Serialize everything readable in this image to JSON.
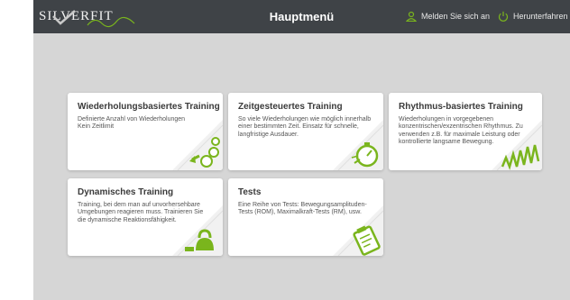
{
  "header": {
    "logo_text": "SILVERFIT",
    "title": "Hauptmenü",
    "login_label": "Melden Sie sich an",
    "shutdown_label": "Herunterfahren"
  },
  "colors": {
    "topbar": "#3f4347",
    "accent": "#7ab51d",
    "background": "#d6d6d6",
    "card": "#ffffff"
  },
  "cards": [
    {
      "title": "Wiederholungsbasiertes Training",
      "description": "Definierte Anzahl von Wiederholungen\nKein Zeitlimit",
      "icon": "repetition-counter-icon"
    },
    {
      "title": "Zeitgesteuertes Training",
      "description": "So viele Wiederholungen wie möglich innerhalb einer bestimmten Zeit. Einsatz für schnelle, langfristige Ausdauer.",
      "icon": "stopwatch-icon"
    },
    {
      "title": "Rhythmus-basiertes Training",
      "description": "Wiederholungen in vorgegebenen konzentrischen/exzentrischen Rhythmus. Zu verwenden z.B. für maximale Leistung oder kontrollierte langsame Bewegung.",
      "icon": "rhythm-wave-icon"
    },
    {
      "title": "Dynamisches Training",
      "description": "Training, bei dem man auf unvorhersehbare Umgebungen reagieren muss. Trainieren Sie die dynamische Reaktionsfähigkeit.",
      "icon": "kettlebell-icon"
    },
    {
      "title": "Tests",
      "description": "Eine Reihe von Tests: Bewegungsamplituden-Tests (ROM), Maximalkraft-Tests (RM), usw.",
      "icon": "clipboard-icon"
    }
  ]
}
